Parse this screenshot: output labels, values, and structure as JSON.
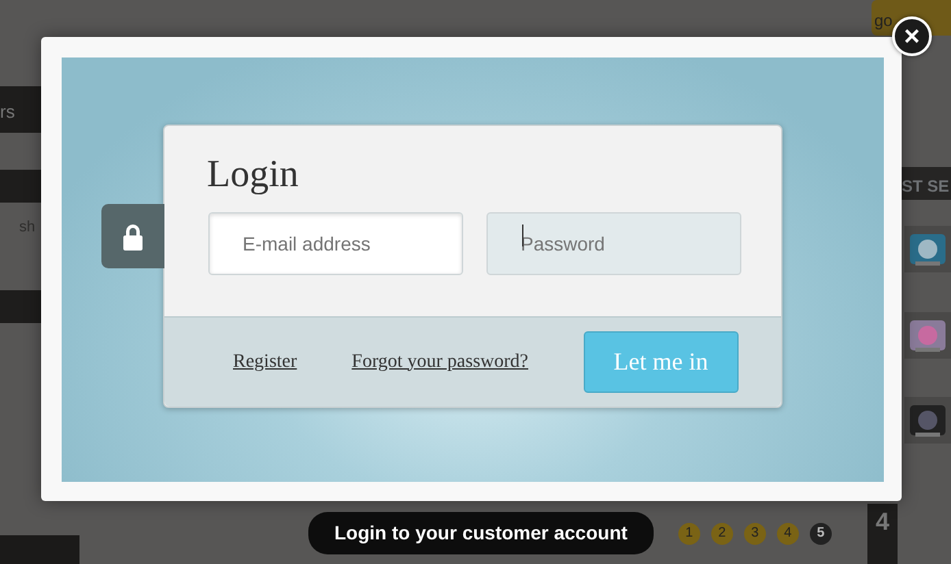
{
  "backdrop": {
    "menu_label": "rs",
    "fragment_left": "sh",
    "section_title": "ST SE",
    "top_button": "go",
    "rank": "4"
  },
  "modal": {
    "close": "×",
    "lock_tab": true,
    "login": {
      "title": "Login",
      "fields": [
        {
          "placeholder": "E-mail address",
          "highlighted": true,
          "focused": false
        },
        {
          "placeholder": "Password",
          "highlighted": false,
          "focused": true
        }
      ],
      "links": [
        "Register",
        "Forgot your password?"
      ],
      "submit": "Let me in"
    }
  },
  "caption": "Login to your customer account",
  "pager": [
    {
      "label": "1",
      "selected": false
    },
    {
      "label": "2",
      "selected": false
    },
    {
      "label": "3",
      "selected": false
    },
    {
      "label": "4",
      "selected": false
    },
    {
      "label": "5",
      "selected": true
    }
  ]
}
